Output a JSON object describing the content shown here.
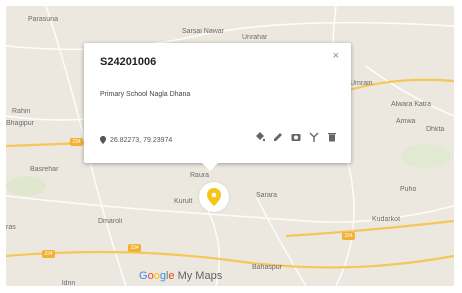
{
  "map": {
    "place_labels": [
      {
        "id": "parasuna",
        "text": "Parasuna"
      },
      {
        "id": "sarsai-nawar",
        "text": "Sarsai Nawar"
      },
      {
        "id": "unrahar",
        "text": "Unrahar"
      },
      {
        "id": "umrain",
        "text": "Umrain"
      },
      {
        "id": "alwara-katra",
        "text": "Alwara Katra"
      },
      {
        "id": "amwa",
        "text": "Amwa"
      },
      {
        "id": "dhkta",
        "text": "Dhkta"
      },
      {
        "id": "rahin",
        "text": "Rahin"
      },
      {
        "id": "bhagipur",
        "text": "Bhagipur"
      },
      {
        "id": "basrehar",
        "text": "Basrehar"
      },
      {
        "id": "raura",
        "text": "Raura"
      },
      {
        "id": "kurult",
        "text": "Kurult"
      },
      {
        "id": "sarara",
        "text": "Sarara"
      },
      {
        "id": "puho",
        "text": "Puho"
      },
      {
        "id": "kudarkot",
        "text": "Kudarkot"
      },
      {
        "id": "dmaroli",
        "text": "Dmaroli"
      },
      {
        "id": "bahaspur",
        "text": "Bahaspur"
      },
      {
        "id": "ras",
        "text": "ras"
      },
      {
        "id": "ldnn",
        "text": "ldnn"
      }
    ],
    "road_shields": [
      {
        "id": "shield-1",
        "text": "234"
      },
      {
        "id": "shield-2",
        "text": "234"
      },
      {
        "id": "shield-3",
        "text": "234"
      },
      {
        "id": "shield-4",
        "text": "334"
      }
    ],
    "road_color": "#f6c65a",
    "land_color": "#ece8df",
    "marker_color": "#f5c518"
  },
  "popup": {
    "title": "S24201006",
    "close": "×",
    "description": "Primary School Nagla Dhana",
    "coordinates": "26.82273, 79.23974",
    "tools": [
      "style-icon",
      "edit-icon",
      "camera-icon",
      "directions-icon",
      "delete-icon"
    ]
  },
  "branding": {
    "google_letters": [
      "G",
      "o",
      "o",
      "g",
      "l",
      "e"
    ],
    "product": "My Maps"
  }
}
